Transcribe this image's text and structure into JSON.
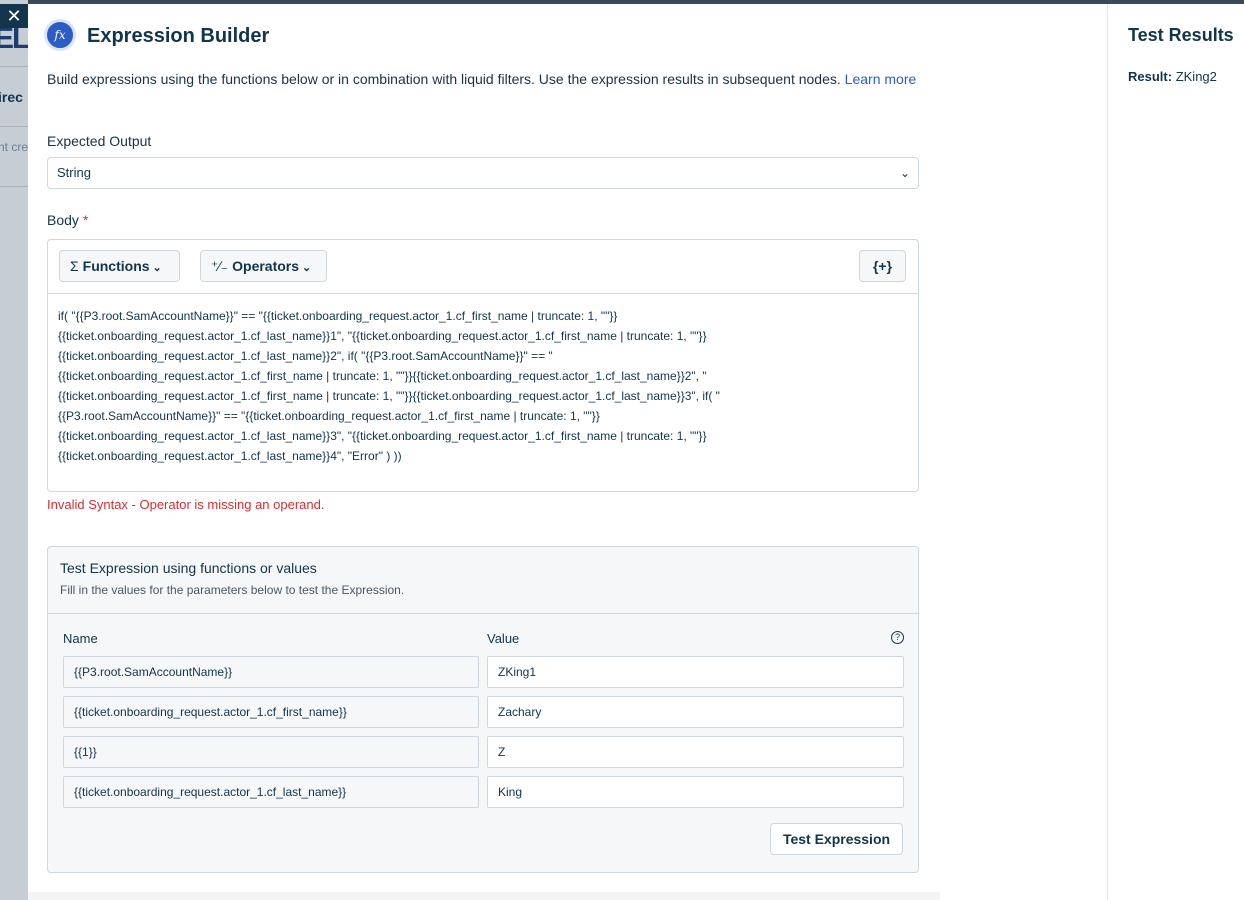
{
  "background": {
    "logo_fragment": "EL",
    "text_fragment_1": "irec",
    "text_fragment_2": "nt cre"
  },
  "close_glyph": "✕",
  "header": {
    "icon_glyph": "fx",
    "title": "Expression Builder"
  },
  "description": {
    "text": "Build expressions using the functions below or in combination with liquid filters. Use the expression results in subsequent nodes. ",
    "link": "Learn more"
  },
  "expected_output": {
    "label": "Expected Output",
    "value": "String",
    "chevron_glyph": "⌄"
  },
  "body": {
    "label": "Body",
    "required_mark": "*",
    "functions_button": {
      "icon": "Σ",
      "label": "Functions",
      "chevron": "⌄"
    },
    "operators_button": {
      "icon": "⁺∕₋",
      "label": "Operators",
      "chevron": "⌄"
    },
    "insert_button": "{+}",
    "expression": "if( \"{{P3.root.SamAccountName}}\" == \"{{ticket.onboarding_request.actor_1.cf_first_name | truncate: 1, \"\"}}\n{{ticket.onboarding_request.actor_1.cf_last_name}}1\", \"{{ticket.onboarding_request.actor_1.cf_first_name | truncate: 1, \"\"}}\n{{ticket.onboarding_request.actor_1.cf_last_name}}2\", if( \"{{P3.root.SamAccountName}}\" == \"\n{{ticket.onboarding_request.actor_1.cf_first_name | truncate: 1, \"\"}}{{ticket.onboarding_request.actor_1.cf_last_name}}2\", \"\n{{ticket.onboarding_request.actor_1.cf_first_name | truncate: 1, \"\"}}{{ticket.onboarding_request.actor_1.cf_last_name}}3\", if( \"\n{{P3.root.SamAccountName}}\" == \"{{ticket.onboarding_request.actor_1.cf_first_name | truncate: 1, \"\"}}\n{{ticket.onboarding_request.actor_1.cf_last_name}}3\", \"{{ticket.onboarding_request.actor_1.cf_first_name | truncate: 1, \"\"}}\n{{ticket.onboarding_request.actor_1.cf_last_name}}4\", \"Error\" ) ))"
  },
  "error_message": "Invalid Syntax - Operator is missing an operand.",
  "test": {
    "title": "Test Expression using functions or values",
    "subtitle": "Fill in the values for the parameters below to test the Expression.",
    "name_header": "Name",
    "value_header": "Value",
    "help_glyph": "?",
    "rows": [
      {
        "name": "{{P3.root.SamAccountName}}",
        "value": "ZKing1"
      },
      {
        "name": "{{ticket.onboarding_request.actor_1.cf_first_name}}",
        "value": "Zachary"
      },
      {
        "name": "{{1}}",
        "value": "Z"
      },
      {
        "name": "{{ticket.onboarding_request.actor_1.cf_last_name}}",
        "value": "King"
      }
    ],
    "button": "Test Expression"
  },
  "results": {
    "title": "Test Results",
    "result_label": "Result:",
    "result_value": "ZKing2"
  },
  "colors": {
    "primary": "#12344d",
    "accent_blue": "#2c5cc5",
    "error_red": "#d72d30",
    "border": "#cfd7df"
  }
}
